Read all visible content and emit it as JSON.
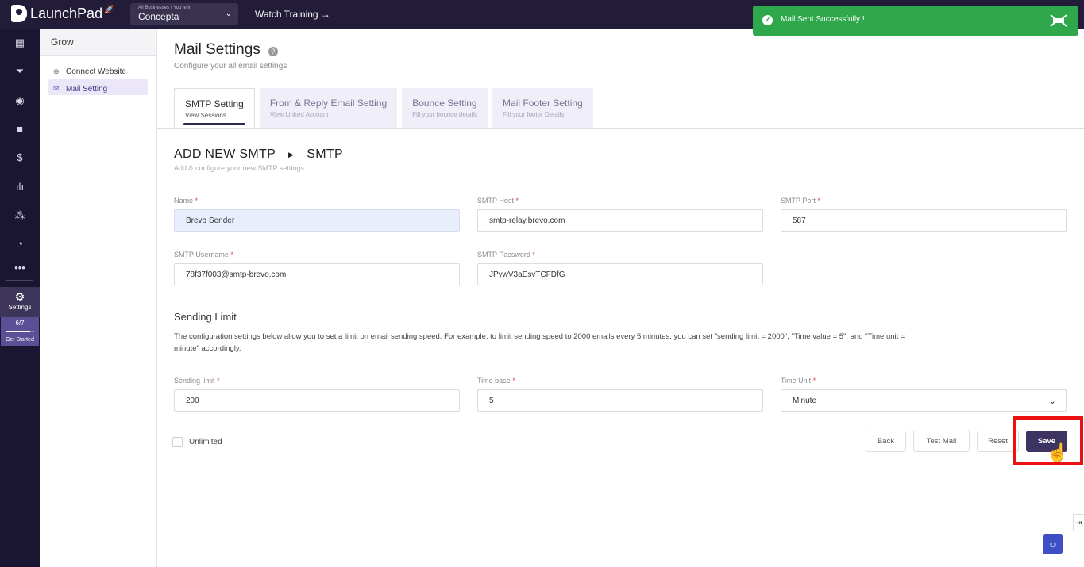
{
  "topbar": {
    "logo_text": "LaunchPad",
    "business_caption": "All Businesses › You're in",
    "business_name": "Concepta",
    "watch_training": "Watch Training →"
  },
  "toast": {
    "message": "Mail Sent Successfully !",
    "color": "#2ea84a"
  },
  "leftnav": {
    "icons": [
      "grid-icon",
      "funnel-icon",
      "globe-icon",
      "video-icon",
      "dollar-icon",
      "chart-icon",
      "users-icon",
      "gauge-icon",
      "more-icon"
    ],
    "settings_label": "Settings",
    "progress_text": "6/7",
    "progress_value": 0.857,
    "get_started": "Get Started"
  },
  "subnav": {
    "heading": "Grow",
    "items": [
      {
        "label": "Connect Website",
        "icon": "globe-icon"
      },
      {
        "label": "Mail Setting",
        "icon": "mail-icon"
      }
    ]
  },
  "main": {
    "title": "Mail Settings",
    "subtitle": "Configure your all email settings",
    "tabs": [
      {
        "label": "SMTP Setting",
        "sub": "View Sessions"
      },
      {
        "label": "From & Reply Email Setting",
        "sub": "View Linked Account"
      },
      {
        "label": "Bounce Setting",
        "sub": "Fill your bounce details"
      },
      {
        "label": "Mail Footer Setting",
        "sub": "Fill your footer Details"
      }
    ],
    "section_title_a": "ADD NEW SMTP",
    "section_title_b": "SMTP",
    "section_sub": "Add & configure your new SMTP settings",
    "fields": {
      "name": {
        "label": "Name",
        "value": "Brevo Sender"
      },
      "host": {
        "label": "SMTP Host",
        "value": "smtp-relay.brevo.com"
      },
      "port": {
        "label": "SMTP Port",
        "value": "587"
      },
      "username": {
        "label": "SMTP Username",
        "value": "78f37f003@smtp-brevo.com"
      },
      "password": {
        "label": "SMTP Password",
        "value": "JPywV3aEsvTCFDfG"
      },
      "sending_limit": {
        "label": "Sending limit",
        "value": "200"
      },
      "time_base": {
        "label": "Time base",
        "value": "5"
      },
      "time_unit": {
        "label": "Time Unit",
        "value": "Minute"
      }
    },
    "required_mark": "*",
    "sending_limit_title": "Sending Limit",
    "sending_limit_desc": "The configuration settings below allow you to set a limit on email sending speed. For example, to limit sending speed to 2000 emails every 5 minutes, you can set \"sending limit = 2000\", \"Time value = 5\", and \"Time unit = minute\" accordingly.",
    "unlimited_label": "Unlimited",
    "buttons": {
      "back": "Back",
      "test_mail": "Test Mail",
      "reset": "Reset",
      "save": "Save"
    }
  }
}
